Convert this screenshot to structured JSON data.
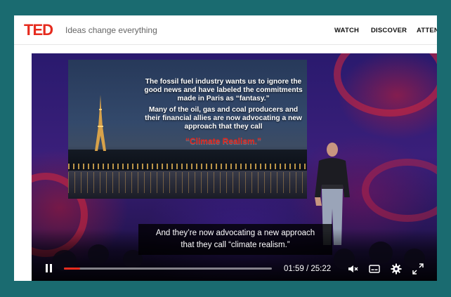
{
  "header": {
    "logo": "TED",
    "tagline": "Ideas change everything",
    "nav": [
      {
        "label": "WATCH"
      },
      {
        "label": "DISCOVER"
      },
      {
        "label": "ATTEN"
      }
    ]
  },
  "slide": {
    "paragraph1": "The fossil fuel industry wants us to ignore the good news and have labeled the commitments made in Paris as “fantasy.”",
    "paragraph2": "Many of the oil, gas and coal producers and their financial allies are now advocating a new approach that they call",
    "accent": "“Climate Realism.”"
  },
  "caption": {
    "line1": "And they’re now advocating a new approach",
    "line2": "that they call “climate realism.”"
  },
  "player": {
    "current_time": "01:59",
    "duration": "25:22",
    "time_display": "01:59 / 25:22",
    "progress_fraction": 0.078,
    "accent_color": "#e62b1e",
    "icons": [
      "pause-icon",
      "mute-icon",
      "subtitles-icon",
      "gear-icon",
      "fullscreen-icon"
    ]
  }
}
